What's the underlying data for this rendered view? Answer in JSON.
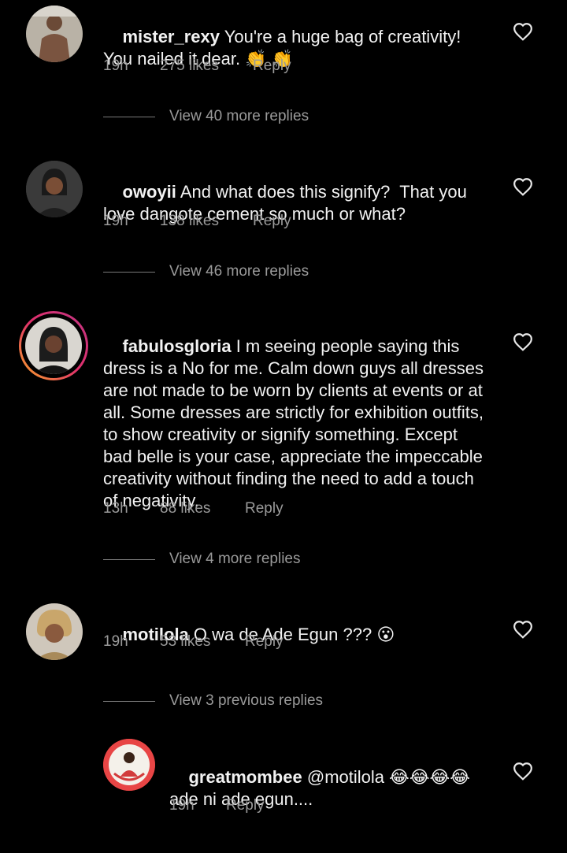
{
  "comments": [
    {
      "username": "mister_rexy",
      "text": "You're a huge bag of creativity! You nailed it dear. 👏 👏",
      "time": "19h",
      "likes": "275 likes",
      "reply": "Reply",
      "view_replies": "View 40 more replies"
    },
    {
      "username": "owoyii",
      "text": "And what does this signify?  That you love dangote cement so much or what?",
      "time": "19h",
      "likes": "138 likes",
      "reply": "Reply",
      "view_replies": "View 46 more replies"
    },
    {
      "username": "fabulosgloria",
      "text": "I m seeing people saying this dress is a No for me. Calm down guys all dresses are not made to be worn by clients at events or at all. Some dresses are strictly for exhibition outfits, to show creativity or signify something. Except bad belle is your case, appreciate the impeccable creativity without finding the need to add a touch of negativity.",
      "time": "13h",
      "likes": "88 likes",
      "reply": "Reply",
      "view_replies": "View 4 more replies"
    },
    {
      "username": "motilola",
      "text": "O wa de Ade Egun ??? 😮",
      "time": "19h",
      "likes": "53 likes",
      "reply": "Reply",
      "view_replies": "View 3 previous replies"
    }
  ],
  "reply_comment": {
    "username": "greatmombee",
    "text": "@motilola 😂😂😂😂 ade ni ade egun....",
    "time": "19h",
    "reply": "Reply"
  },
  "icons": {
    "like": "heart-outline-icon"
  },
  "colors": {
    "background": "#000000",
    "primary_text": "#f2f2f2",
    "secondary_text": "#9a9a9a",
    "story_ring_start": "#f9a825",
    "story_ring_end": "#c13584"
  }
}
